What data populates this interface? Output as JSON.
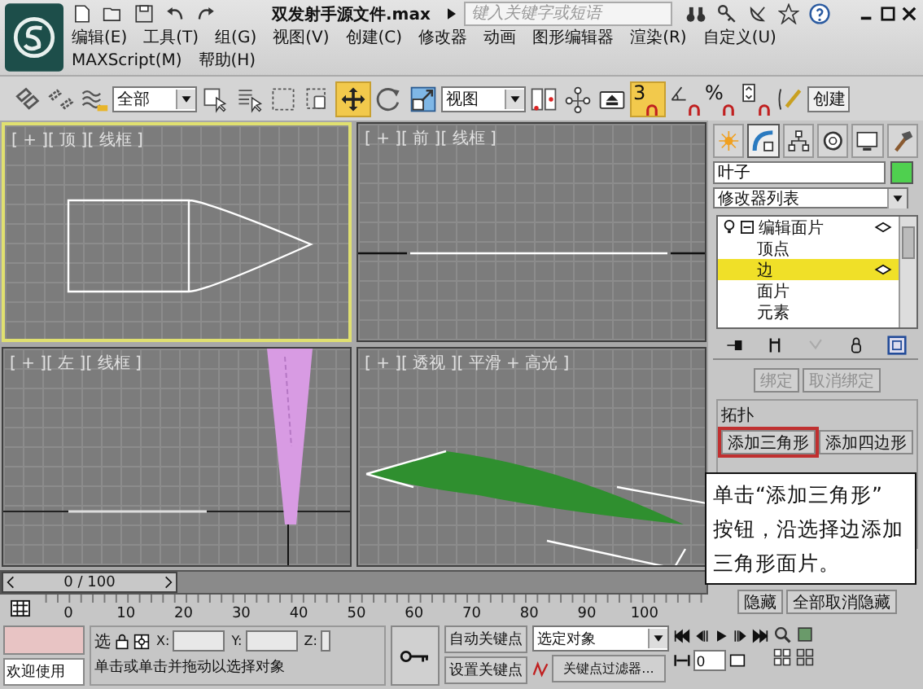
{
  "window": {
    "title": "双发射手源文件.max",
    "search_placeholder": "键入关键字或短语"
  },
  "menu": [
    "编辑(E)",
    "工具(T)",
    "组(G)",
    "视图(V)",
    "创建(C)",
    "修改器",
    "动画",
    "图形编辑器",
    "渲染(R)",
    "自定义(U)",
    "MAXScript(M)",
    "帮助(H)"
  ],
  "toolbar": {
    "selection_filter": "全部",
    "transform_tools": [
      {
        "kind": "move",
        "selected": true
      },
      {
        "kind": "rotate",
        "selected": false
      },
      {
        "kind": "scale",
        "selected": false
      }
    ],
    "reference_coordinate": "视图",
    "snaps": [
      {
        "kind": "snap",
        "label": "3",
        "selected": true
      },
      {
        "kind": "angle",
        "selected": false
      },
      {
        "kind": "percent",
        "label": "%",
        "selected": false
      },
      {
        "kind": "spinner",
        "selected": false
      }
    ],
    "named_selection": "创建"
  },
  "viewports": [
    {
      "kind": "top",
      "label": "[ + ][ 顶 ][ 线框 ]",
      "selected": true
    },
    {
      "kind": "front",
      "label": "[ + ][ 前 ][ 线框 ]",
      "selected": false
    },
    {
      "kind": "left",
      "label": "[ + ][ 左 ][ 线框 ]",
      "selected": false
    },
    {
      "kind": "perspective",
      "label": "[ + ][ 透视 ][ 平滑 + 高光 ]",
      "selected": false
    }
  ],
  "time_slider": {
    "label": "0 / 100",
    "level": 0
  },
  "ruler_ticks": [
    "0",
    "10",
    "20",
    "30",
    "40",
    "50",
    "60",
    "70",
    "80",
    "90",
    "100"
  ],
  "command_panel": {
    "tabs": [
      {
        "kind": "create",
        "selected": false
      },
      {
        "kind": "modify",
        "selected": true
      },
      {
        "kind": "hierarchy",
        "selected": false
      },
      {
        "kind": "motion",
        "selected": false
      },
      {
        "kind": "display",
        "selected": false
      },
      {
        "kind": "utilities",
        "selected": false
      }
    ],
    "object_name": "叶子",
    "modifier_list": "修改器列表",
    "stack": [
      {
        "label": "编辑面片",
        "expanded": true,
        "selected": false,
        "children": [
          {
            "label": "顶点",
            "selected": false
          },
          {
            "label": "边",
            "selected": true
          },
          {
            "label": "面片",
            "selected": false
          },
          {
            "label": "元素",
            "selected": false
          }
        ]
      }
    ],
    "bind_buttons": [
      {
        "label": "绑定",
        "disabled": true
      },
      {
        "label": "取消绑定",
        "disabled": true
      }
    ],
    "topology": {
      "title": "拓扑",
      "buttons": [
        {
          "label": "添加三角形",
          "highlighted": true
        },
        {
          "label": "添加四边形",
          "highlighted": false
        }
      ]
    },
    "visibility_buttons": [
      {
        "label": "隐藏",
        "disabled": false
      },
      {
        "label": "全部取消隐藏",
        "disabled": false
      }
    ]
  },
  "callout": [
    "单击“添加三角形”",
    "按钮，沿选择边添加",
    "三角形面片。"
  ],
  "status_bar": {
    "welcome": "欢迎使用",
    "selection_label": "选",
    "coordinates": [
      "X:",
      "Y:",
      "Z:"
    ],
    "prompt": "单击或单击并拖动以选择对象",
    "auto_key": "自动关键点",
    "set_key": "设置关键点",
    "key_mode": "选定对象",
    "key_filters": "关键点过滤器...",
    "frame": "0"
  }
}
